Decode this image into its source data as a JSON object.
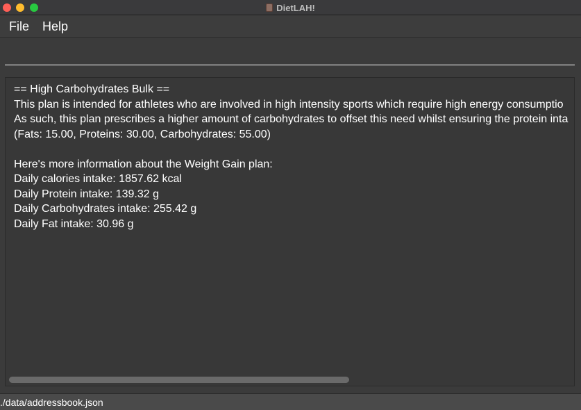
{
  "window": {
    "title": "DietLAH!"
  },
  "menu": {
    "items": [
      "File",
      "Help"
    ]
  },
  "command_box": {
    "value": "",
    "placeholder": ""
  },
  "result_display": {
    "lines": [
      "== High Carbohydrates Bulk ==",
      "This plan is intended for athletes who are involved in high intensity sports which require high energy consumptio",
      "As such, this plan prescribes a higher amount of carbohydrates to offset this need whilst ensuring the protein inta",
      "(Fats: 15.00, Proteins: 30.00, Carbohydrates: 55.00)",
      "",
      "Here's more information about the Weight Gain plan:",
      "Daily calories intake: 1857.62 kcal",
      "Daily Protein intake: 139.32 g",
      "Daily Carbohydrates intake: 255.42 g",
      "Daily Fat intake: 30.96 g"
    ]
  },
  "status_bar": {
    "save_location": "./data/addressbook.json"
  },
  "colors": {
    "background": "#3b3b3b",
    "text": "#ffffff",
    "close": "#ff5f57",
    "minimize": "#febc2e",
    "maximize": "#28c840"
  }
}
